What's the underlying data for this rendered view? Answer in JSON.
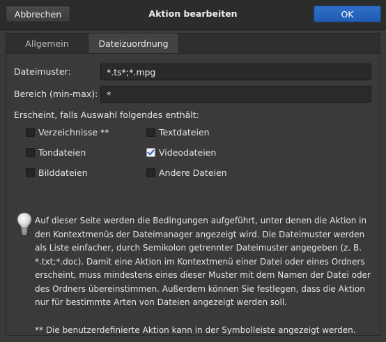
{
  "window": {
    "title": "Aktion bearbeiten",
    "cancel_label": "Abbrechen",
    "ok_label": "OK"
  },
  "tabs": [
    {
      "label": "Allgemein",
      "active": false
    },
    {
      "label": "Dateizuordnung",
      "active": true
    }
  ],
  "form": {
    "pattern_label": "Dateimuster:",
    "pattern_value": "*.ts*;*.mpg",
    "range_label": "Bereich (min-max):",
    "range_value": "*",
    "appears_label": "Erscheint, falls Auswahl folgendes enthält:"
  },
  "checkboxes": [
    {
      "label": "Verzeichnisse **",
      "checked": false
    },
    {
      "label": "Textdateien",
      "checked": false
    },
    {
      "label": "Tondateien",
      "checked": false
    },
    {
      "label": "Videodateien",
      "checked": true
    },
    {
      "label": "Bilddateien",
      "checked": false
    },
    {
      "label": "Andere Dateien",
      "checked": false
    }
  ],
  "help": {
    "icon": "lightbulb-icon",
    "text": "Auf dieser Seite werden die Bedingungen aufgeführt, unter denen die Aktion in den Kontextmenüs der Dateimanager angezeigt wird. Die Dateimuster werden als Liste einfacher, durch Semikolon getrennter Dateimuster angegeben (z. B. *.txt;*.doc). Damit eine Aktion im Kontextmenü einer Datei oder eines Ordners erscheint, muss mindestens eines dieser Muster mit dem Namen der Datei oder des Ordners übereinstimmen. Außerdem können Sie festlegen, dass die Aktion nur für bestimmte Arten von Dateien angezeigt werden soll.",
    "note": "** Die benutzerdefinierte Aktion kann in der Symbolleiste angezeigt werden."
  },
  "colors": {
    "background": "#3a3a3a",
    "titlebar": "#2c2c2c",
    "accent": "#2f6ec8"
  }
}
